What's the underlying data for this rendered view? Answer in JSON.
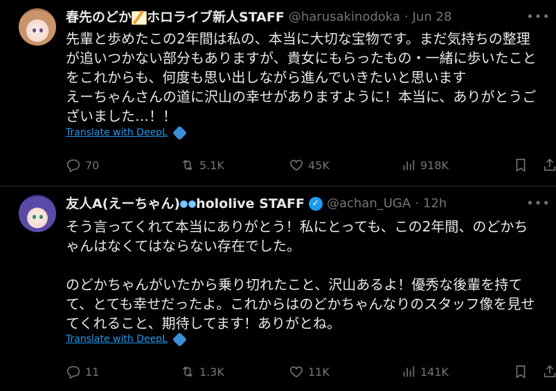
{
  "tweets": [
    {
      "name": "春先のどか",
      "name_suffix": "ホロライブ新人STAFF",
      "handle": "@harusakinodoka",
      "time": "Jun 28",
      "text": "先輩と歩めたこの2年間は私の、本当に大切な宝物です。まだ気持ちの整理\nが追いつかない部分もありますが、貴女にもらったもの・一緒に歩いたこと\nをこれからも、何度も思い出しながら進んでいきたいと思います\nえーちゃんさんの道に沢山の幸せがありますように！本当に、ありがとうご\nざいました…！！",
      "translate": "Translate with DeepL",
      "replies": "70",
      "retweets": "5.1K",
      "likes": "45K",
      "views": "918K"
    },
    {
      "name": "友人A(えーちゃん)",
      "name_suffix": "hololive STAFF",
      "handle": "@achan_UGA",
      "time": "12h",
      "text": "そう言ってくれて本当にありがとう！私にとっても、この2年間、のどかち\nゃんはなくてはならない存在でした。\n\nのどかちゃんがいたから乗り切れたこと、沢山あるよ！優秀な後輩を持て\nて、とても幸せだったよ。これからはのどかちゃんなりのスタッフ像を見せ\nてくれること、期待してます！ありがとね。",
      "translate": "Translate with DeepL",
      "replies": "11",
      "retweets": "1.3K",
      "likes": "11K",
      "views": "141K"
    }
  ],
  "dot": "·",
  "colors": {
    "accent": "#1d9bf0",
    "muted": "#71767b",
    "text": "#e7e9ea",
    "bg": "#000000"
  }
}
